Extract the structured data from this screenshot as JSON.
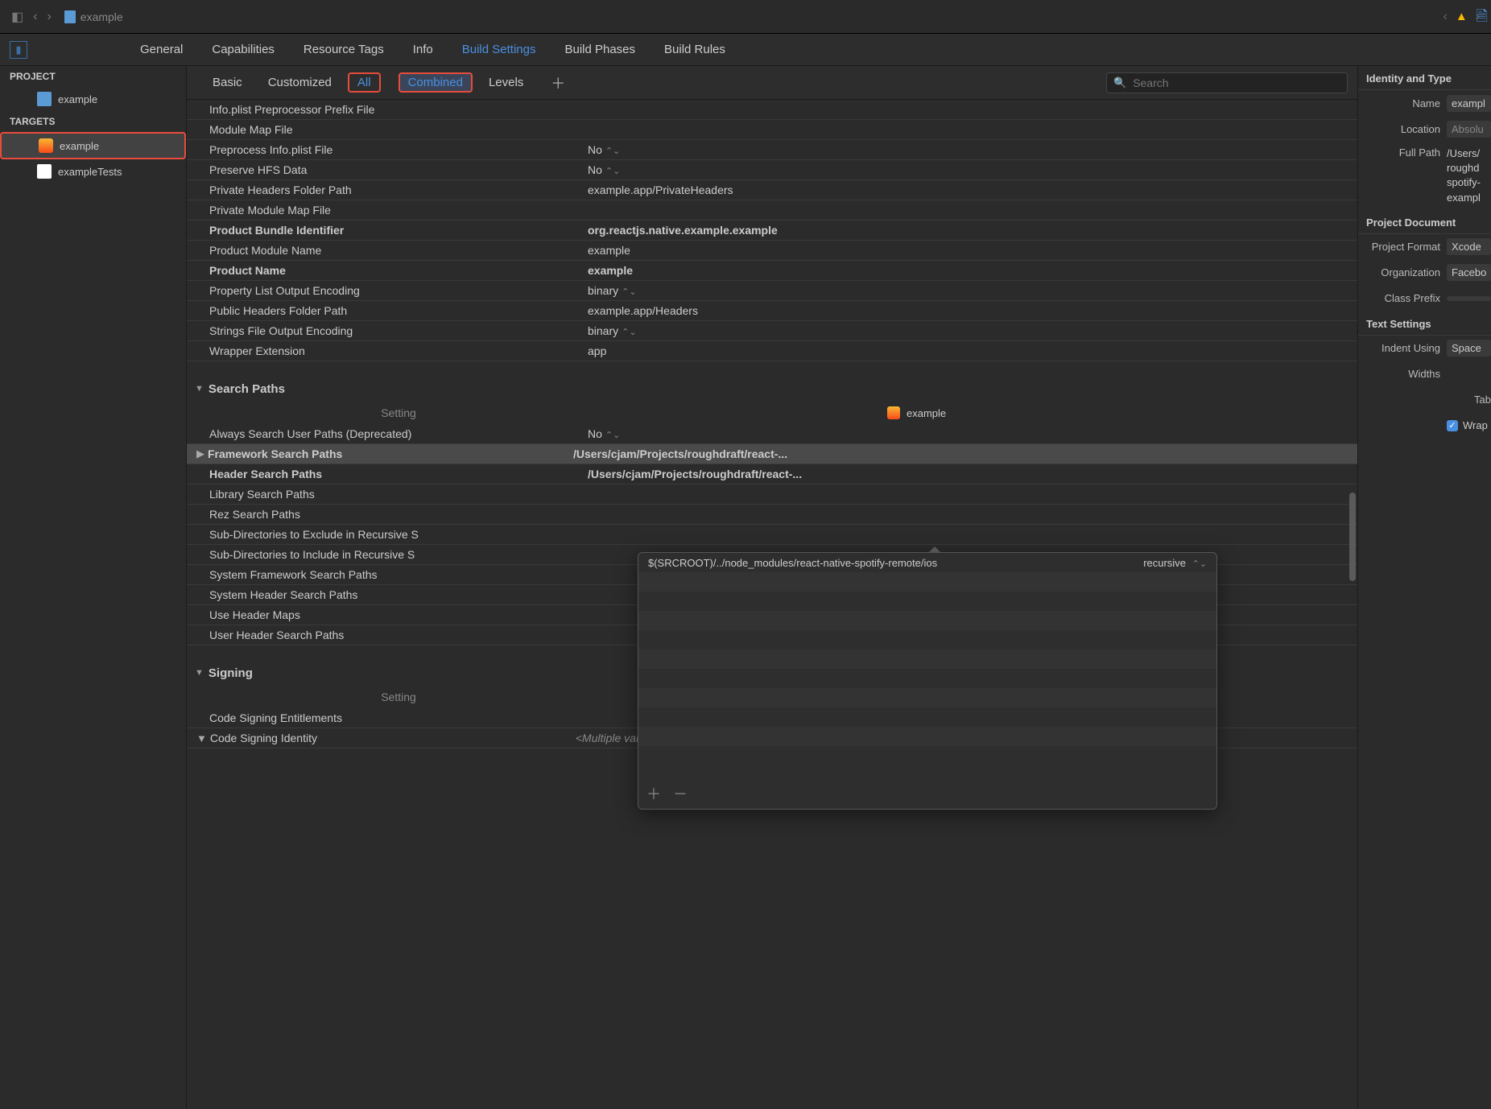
{
  "titlebar": {
    "doc": "example"
  },
  "tabs": {
    "general": "General",
    "capabilities": "Capabilities",
    "resource_tags": "Resource Tags",
    "info": "Info",
    "build_settings": "Build Settings",
    "build_phases": "Build Phases",
    "build_rules": "Build Rules"
  },
  "sidebar": {
    "project_label": "PROJECT",
    "project_name": "example",
    "targets_label": "TARGETS",
    "target_app": "example",
    "target_tests": "exampleTests"
  },
  "filter": {
    "basic": "Basic",
    "customized": "Customized",
    "all": "All",
    "combined": "Combined",
    "levels": "Levels",
    "search_ph": "Search"
  },
  "packaging": {
    "infoplist_prefix": {
      "k": "Info.plist Preprocessor Prefix File",
      "v": ""
    },
    "module_map": {
      "k": "Module Map File",
      "v": ""
    },
    "preprocess_infoplist": {
      "k": "Preprocess Info.plist File",
      "v": "No"
    },
    "preserve_hfs": {
      "k": "Preserve HFS Data",
      "v": "No"
    },
    "private_headers": {
      "k": "Private Headers Folder Path",
      "v": "example.app/PrivateHeaders"
    },
    "private_module_map": {
      "k": "Private Module Map File",
      "v": ""
    },
    "bundle_id": {
      "k": "Product Bundle Identifier",
      "v": "org.reactjs.native.example.example"
    },
    "product_module_name": {
      "k": "Product Module Name",
      "v": "example"
    },
    "product_name": {
      "k": "Product Name",
      "v": "example"
    },
    "plist_encoding": {
      "k": "Property List Output Encoding",
      "v": "binary"
    },
    "public_headers": {
      "k": "Public Headers Folder Path",
      "v": "example.app/Headers"
    },
    "strings_encoding": {
      "k": "Strings File Output Encoding",
      "v": "binary"
    },
    "wrapper_ext": {
      "k": "Wrapper Extension",
      "v": "app"
    }
  },
  "search_paths": {
    "section": "Search Paths",
    "col_setting": "Setting",
    "col_target": "example",
    "always_user": {
      "k": "Always Search User Paths (Deprecated)",
      "v": "No"
    },
    "framework": {
      "k": "Framework Search Paths",
      "v": "/Users/cjam/Projects/roughdraft/react-..."
    },
    "header": {
      "k": "Header Search Paths",
      "v": "/Users/cjam/Projects/roughdraft/react-..."
    },
    "library": {
      "k": "Library Search Paths",
      "v": ""
    },
    "rez": {
      "k": "Rez Search Paths",
      "v": ""
    },
    "sub_exclude": {
      "k": "Sub-Directories to Exclude in Recursive S",
      "v": ""
    },
    "sub_include": {
      "k": "Sub-Directories to Include in Recursive S",
      "v": ""
    },
    "sys_framework": {
      "k": "System Framework Search Paths",
      "v": ""
    },
    "sys_header": {
      "k": "System Header Search Paths",
      "v": ""
    },
    "use_header_maps": {
      "k": "Use Header Maps",
      "v": ""
    },
    "user_header": {
      "k": "User Header Search Paths",
      "v": ""
    }
  },
  "signing": {
    "section": "Signing",
    "col_setting": "Setting",
    "entitlements": {
      "k": "Code Signing Entitlements",
      "v": ""
    },
    "identity": {
      "k": "Code Signing Identity",
      "v": "<Multiple values>"
    }
  },
  "popup": {
    "path": "$(SRCROOT)/../node_modules/react-native-spotify-remote/ios",
    "mode": "recursive"
  },
  "inspector": {
    "identity_section": "Identity and Type",
    "name_lbl": "Name",
    "name_val": "exampl",
    "location_lbl": "Location",
    "location_val": "Absolu",
    "fullpath_lbl": "Full Path",
    "fullpath_val": "/Users/\nroughd\nspotify-\nexampl",
    "projdoc_section": "Project Document",
    "projfmt_lbl": "Project Format",
    "projfmt_val": "Xcode",
    "org_lbl": "Organization",
    "org_val": "Facebo",
    "classprefix_lbl": "Class Prefix",
    "classprefix_val": "",
    "text_section": "Text Settings",
    "indent_lbl": "Indent Using",
    "indent_val": "Space",
    "widths_lbl": "Widths",
    "tab_lbl": "Tab",
    "wrap_lbl": "Wrap"
  }
}
